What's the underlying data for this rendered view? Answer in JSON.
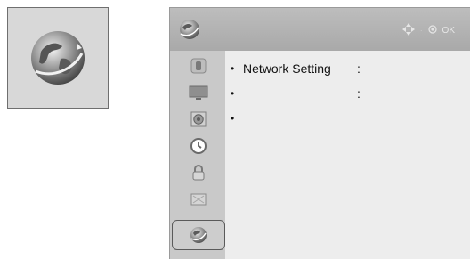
{
  "menu": {
    "hint": {
      "ok_label": "OK"
    },
    "items": [
      {
        "label": "Network Setting",
        "separator": ":"
      },
      {
        "label": "",
        "separator": ":"
      },
      {
        "label": "",
        "separator": ""
      }
    ],
    "sidebar_icons": [
      "picture-icon",
      "monitor-icon",
      "speaker-icon",
      "clock-icon",
      "lock-icon",
      "input-icon",
      "network-globe-icon"
    ]
  }
}
